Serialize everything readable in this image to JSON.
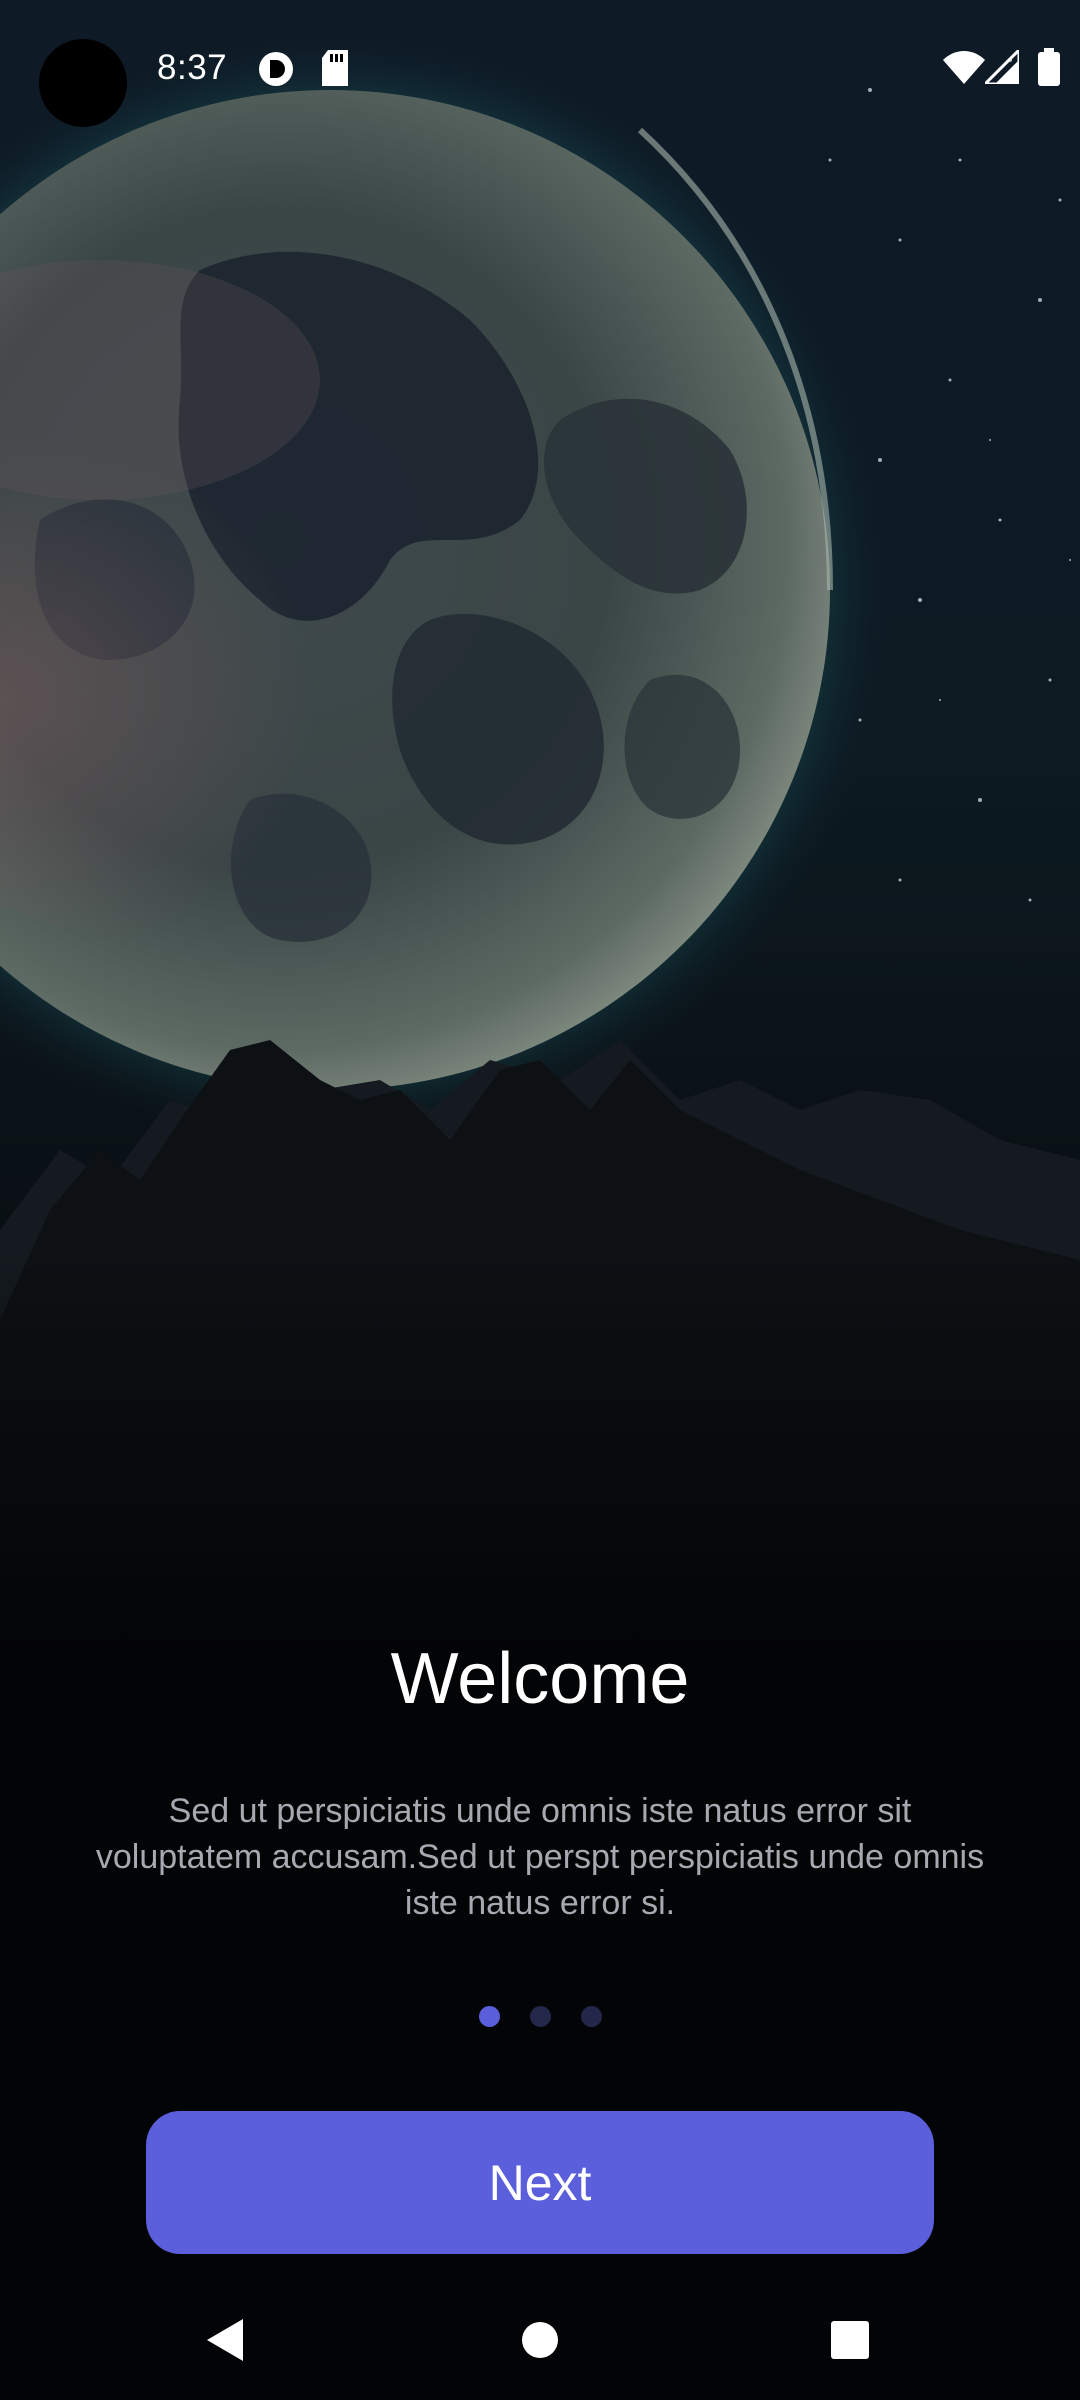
{
  "status_bar": {
    "time": "8:37",
    "icons": [
      "vpn-key-icon",
      "sd-card-icon",
      "wifi-icon",
      "cellular-signal-icon",
      "battery-icon"
    ]
  },
  "onboarding": {
    "title": "Welcome",
    "body": "Sed ut perspiciatis unde omnis iste natus error sit voluptatem accusam.Sed ut perspt perspiciatis unde omnis iste natus error si.",
    "page_indicator": {
      "current": 1,
      "total": 3
    },
    "next_label": "Next"
  },
  "nav_bar": {
    "buttons": [
      "back-icon",
      "home-icon",
      "recents-icon"
    ]
  },
  "colors": {
    "accent": "#5b5fdb",
    "dot_inactive": "#23284a",
    "background": "#030406",
    "title": "#ffffff",
    "body_text": "#a7a9b0"
  }
}
